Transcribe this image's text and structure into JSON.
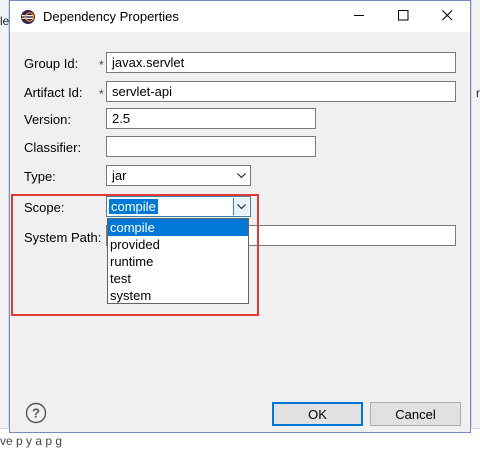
{
  "background": {
    "left_fragment": "le",
    "right_fragment": "r",
    "bottom_fragment": "ve    p    y    a    p    g"
  },
  "dialog": {
    "title": "Dependency Properties",
    "required_marker": "*"
  },
  "form": {
    "group_id": {
      "label": "Group Id:",
      "value": "javax.servlet"
    },
    "artifact_id": {
      "label": "Artifact Id:",
      "value": "servlet-api"
    },
    "version": {
      "label": "Version:",
      "value": "2.5"
    },
    "classifier": {
      "label": "Classifier:",
      "value": ""
    },
    "type": {
      "label": "Type:",
      "value": "jar"
    },
    "scope": {
      "label": "Scope:",
      "value": "compile",
      "options": [
        "compile",
        "provided",
        "runtime",
        "test",
        "system"
      ]
    },
    "system_path": {
      "label": "System Path:",
      "value": ""
    }
  },
  "buttons": {
    "ok": "OK",
    "cancel": "Cancel"
  },
  "colors": {
    "selection": "#0078d7",
    "annotation_box": "#e53935"
  }
}
